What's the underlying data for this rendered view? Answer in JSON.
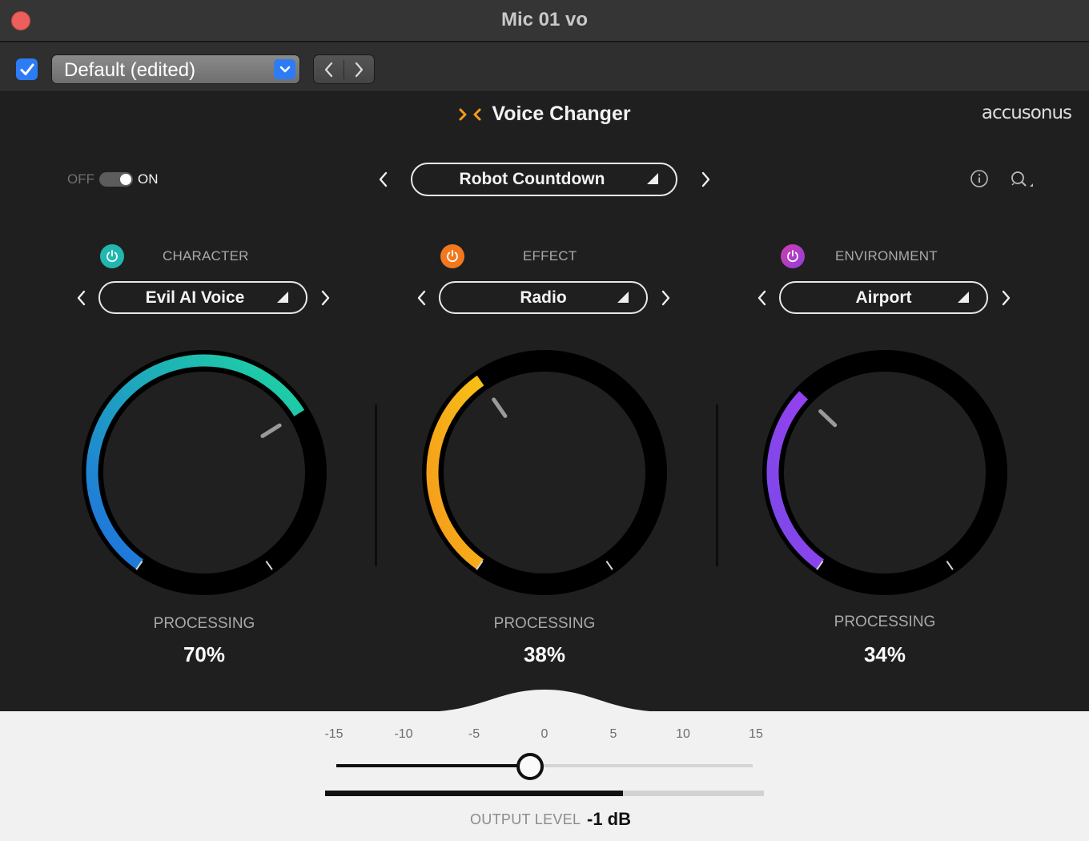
{
  "window": {
    "title": "Mic 01 vo"
  },
  "toolbar": {
    "preset_label": "Default (edited)"
  },
  "plugin": {
    "name": "Voice Changer",
    "brand": "accusonus",
    "off_label": "OFF",
    "on_label": "ON",
    "preset": "Robot Countdown",
    "enabled": true
  },
  "sections": [
    {
      "title": "CHARACTER",
      "selection": "Evil AI Voice",
      "processing_label": "PROCESSING",
      "processing_value": "70%",
      "processing_fraction": 0.7,
      "color_start": "#1f6fe0",
      "color_end": "#1ed6a0"
    },
    {
      "title": "EFFECT",
      "selection": "Radio",
      "processing_label": "PROCESSING",
      "processing_value": "38%",
      "processing_fraction": 0.38,
      "color_start": "#f59a1b",
      "color_end": "#f7c016"
    },
    {
      "title": "ENVIRONMENT",
      "selection": "Airport",
      "processing_label": "PROCESSING",
      "processing_value": "34%",
      "processing_fraction": 0.34,
      "color_start": "#7a4ae8",
      "color_end": "#9a3ef0"
    }
  ],
  "output": {
    "ticks": [
      "-15",
      "-10",
      "-5",
      "0",
      "5",
      "10",
      "15"
    ],
    "label": "OUTPUT LEVEL",
    "value": "-1 dB",
    "level_db": -1
  },
  "colors": {
    "accent_blue": "#2d7cf6",
    "close_red": "#ec5f5a",
    "brand_orange": "#f59a1b"
  }
}
